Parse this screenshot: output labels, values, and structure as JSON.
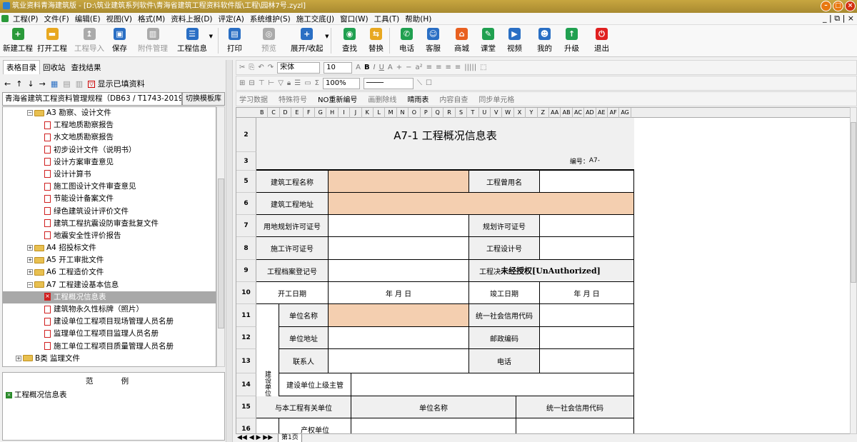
{
  "window": {
    "title": "筑业资料青海建筑版 - [D:\\筑业建筑系列软件\\青海省建筑工程资料软件版\\工程\\园林7号.zyzl]"
  },
  "menu": [
    "工程(P)",
    "文件(F)",
    "编辑(E)",
    "视图(V)",
    "格式(M)",
    "资料上报(D)",
    "评定(A)",
    "系统维护(S)",
    "施工交底(J)",
    "窗口(W)",
    "工具(T)",
    "帮助(H)"
  ],
  "menu_right": "_ | ⧉ | ×",
  "toolbar": [
    {
      "label": "新建工程",
      "color": "#2a9a3a",
      "glyph": "+",
      "disabled": false
    },
    {
      "label": "打开工程",
      "color": "#e8a820",
      "glyph": "▬",
      "disabled": false
    },
    {
      "label": "工程导入",
      "color": "#aaaaaa",
      "glyph": "↥",
      "disabled": true
    },
    {
      "label": "保存",
      "color": "#2a6fc4",
      "glyph": "▣",
      "disabled": false
    },
    {
      "label": "附件管理",
      "color": "#aaaaaa",
      "glyph": "▥",
      "disabled": true
    },
    {
      "label": "工程信息",
      "color": "#2a6fc4",
      "glyph": "☰",
      "disabled": false
    },
    {
      "label": "打印",
      "color": "#2a6fc4",
      "glyph": "▤",
      "disabled": false
    },
    {
      "label": "预览",
      "color": "#aaaaaa",
      "glyph": "◎",
      "disabled": true
    },
    {
      "label": "展开/收起",
      "color": "#2a6fc4",
      "glyph": "+",
      "disabled": false
    },
    {
      "label": "查找",
      "color": "#20a050",
      "glyph": "◉",
      "disabled": false
    },
    {
      "label": "替换",
      "color": "#e8a820",
      "glyph": "⇆",
      "disabled": false
    },
    {
      "label": "电话",
      "color": "#20a050",
      "glyph": "✆",
      "disabled": false
    },
    {
      "label": "客服",
      "color": "#2a6fc4",
      "glyph": "☺",
      "disabled": false
    },
    {
      "label": "商城",
      "color": "#e86020",
      "glyph": "⌂",
      "disabled": false
    },
    {
      "label": "课堂",
      "color": "#20a050",
      "glyph": "✎",
      "disabled": false
    },
    {
      "label": "视频",
      "color": "#2a6fc4",
      "glyph": "▶",
      "disabled": false
    },
    {
      "label": "我的",
      "color": "#2a6fc4",
      "glyph": "☻",
      "disabled": false
    },
    {
      "label": "升级",
      "color": "#20a050",
      "glyph": "↑",
      "disabled": false
    },
    {
      "label": "退出",
      "color": "#e02020",
      "glyph": "⏻",
      "disabled": false
    }
  ],
  "left": {
    "tabs": [
      "表格目录",
      "回收站",
      "查找结果"
    ],
    "show_filled": "显示已填资料",
    "spec": "青海省建筑工程资料管理规程（DB63 / T1743-2019）",
    "switch": "切换模板库",
    "tree": [
      {
        "type": "folder",
        "expand": "−",
        "label": "A3 勘察、设计文件",
        "indent": 34
      },
      {
        "type": "doc",
        "label": "工程地质勘察报告",
        "indent": 58
      },
      {
        "type": "doc",
        "label": "水文地质勘察报告",
        "indent": 58
      },
      {
        "type": "doc",
        "label": "初步设计文件（说明书）",
        "indent": 58
      },
      {
        "type": "doc",
        "label": "设计方案审查意见",
        "indent": 58
      },
      {
        "type": "doc",
        "label": "设计计算书",
        "indent": 58
      },
      {
        "type": "doc",
        "label": "施工图设计文件审查意见",
        "indent": 58
      },
      {
        "type": "doc",
        "label": "节能设计备案文件",
        "indent": 58
      },
      {
        "type": "doc",
        "label": "绿色建筑设计评价文件",
        "indent": 58
      },
      {
        "type": "doc",
        "label": "建筑工程抗震设防审查批复文件",
        "indent": 58
      },
      {
        "type": "doc",
        "label": "地震安全性评价报告",
        "indent": 58
      },
      {
        "type": "folder",
        "expand": "+",
        "label": "A4 招投标文件",
        "indent": 34
      },
      {
        "type": "folder",
        "expand": "+",
        "label": "A5 开工审批文件",
        "indent": 34
      },
      {
        "type": "folder",
        "expand": "+",
        "label": "A6 工程造价文件",
        "indent": 34
      },
      {
        "type": "folder",
        "expand": "−",
        "label": "A7 工程建设基本信息",
        "indent": 34
      },
      {
        "type": "docx",
        "label": "工程概况信息表",
        "indent": 58,
        "selected": true
      },
      {
        "type": "doc",
        "label": "建筑物永久性标牌（照片）",
        "indent": 58
      },
      {
        "type": "doc",
        "label": "建设单位工程项目现场管理人员名册",
        "indent": 58
      },
      {
        "type": "doc",
        "label": "监理单位工程项目监理人员名册",
        "indent": 58
      },
      {
        "type": "doc",
        "label": "施工单位工程项目质量管理人员名册",
        "indent": 58
      },
      {
        "type": "folder",
        "expand": "+",
        "label": "B类 监理文件",
        "indent": 18
      }
    ],
    "legend_title": "范 例",
    "legend_item": "工程概况信息表"
  },
  "format_bar1": {
    "font": "宋体",
    "size": "10",
    "zoom": "100%"
  },
  "format_bar3": [
    "学习数据",
    "特殊符号",
    "NO重新编号",
    "画删除线",
    "晴雨表",
    "内容自查",
    "同步单元格"
  ],
  "sheet": {
    "columns": [
      "B",
      "C",
      "D",
      "E",
      "F",
      "G",
      "H",
      "I",
      "J",
      "K",
      "L",
      "M",
      "N",
      "O",
      "P",
      "Q",
      "R",
      "S",
      "T",
      "U",
      "V",
      "W",
      "X",
      "Y",
      "Z",
      "AA",
      "AB",
      "AC",
      "AD",
      "AE",
      "AF",
      "AG"
    ],
    "title": "A7-1   工程概况信息表",
    "code_label": "编号：",
    "code_value": "A7-",
    "rows": [
      "2",
      "3",
      "5",
      "6",
      "7",
      "8",
      "9",
      "10",
      "11",
      "12",
      "13",
      "14",
      "15",
      "16"
    ],
    "labels": {
      "proj_name": "建筑工程名称",
      "former_name": "工程曾用名",
      "proj_addr": "建筑工程地址",
      "land_permit": "用地规划许可证号",
      "plan_permit": "规划许可证号",
      "build_permit": "施工许可证号",
      "design_no": "工程设计号",
      "archive_no": "工程档案登记号",
      "proj_x": "工程决",
      "unauth": "未经授权[UnAuthorized]",
      "start_date": "开工日期",
      "end_date": "竣工日期",
      "date_fmt": "年   月   日",
      "owner_group": "建设单位",
      "unit_name": "单位名称",
      "credit_code": "统一社会信用代码",
      "unit_addr": "单位地址",
      "postcode": "邮政编码",
      "contact": "联系人",
      "phone": "电话",
      "superior": "建设单位上级主管",
      "related": "与本工程有关单位",
      "related_name": "单位名称",
      "related_code": "统一社会信用代码",
      "property": "产权单位"
    },
    "sheet_tab": "第1页"
  }
}
